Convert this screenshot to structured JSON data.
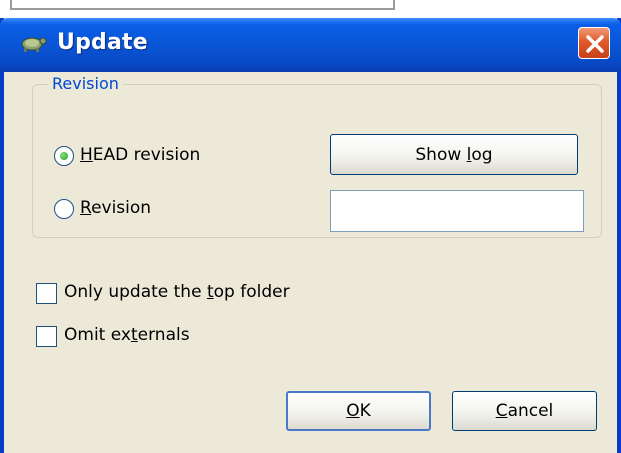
{
  "dialog": {
    "title": "Update"
  },
  "revision_group": {
    "label": "Revision",
    "head_radio": {
      "label_u": "H",
      "label_rest": "EAD revision",
      "checked": true
    },
    "revision_radio": {
      "label_u": "R",
      "label_rest": "evision",
      "checked": false
    },
    "show_log": {
      "pre": "Show ",
      "u": "l",
      "post": "og"
    },
    "revision_input": {
      "value": ""
    }
  },
  "options": {
    "top_folder": {
      "pre": "Only update the ",
      "u": "t",
      "post": "op folder",
      "checked": false
    },
    "externals": {
      "pre": "Omit ex",
      "u": "t",
      "post": "ernals",
      "checked": false
    }
  },
  "buttons": {
    "ok": {
      "u": "O",
      "rest": "K"
    },
    "cancel": {
      "u": "C",
      "rest": "ancel"
    }
  },
  "colors": {
    "titlebar": "#0a56d8",
    "dialog_bg": "#ece9d8",
    "group_label": "#0046d5",
    "close_button": "#e05a2a"
  }
}
